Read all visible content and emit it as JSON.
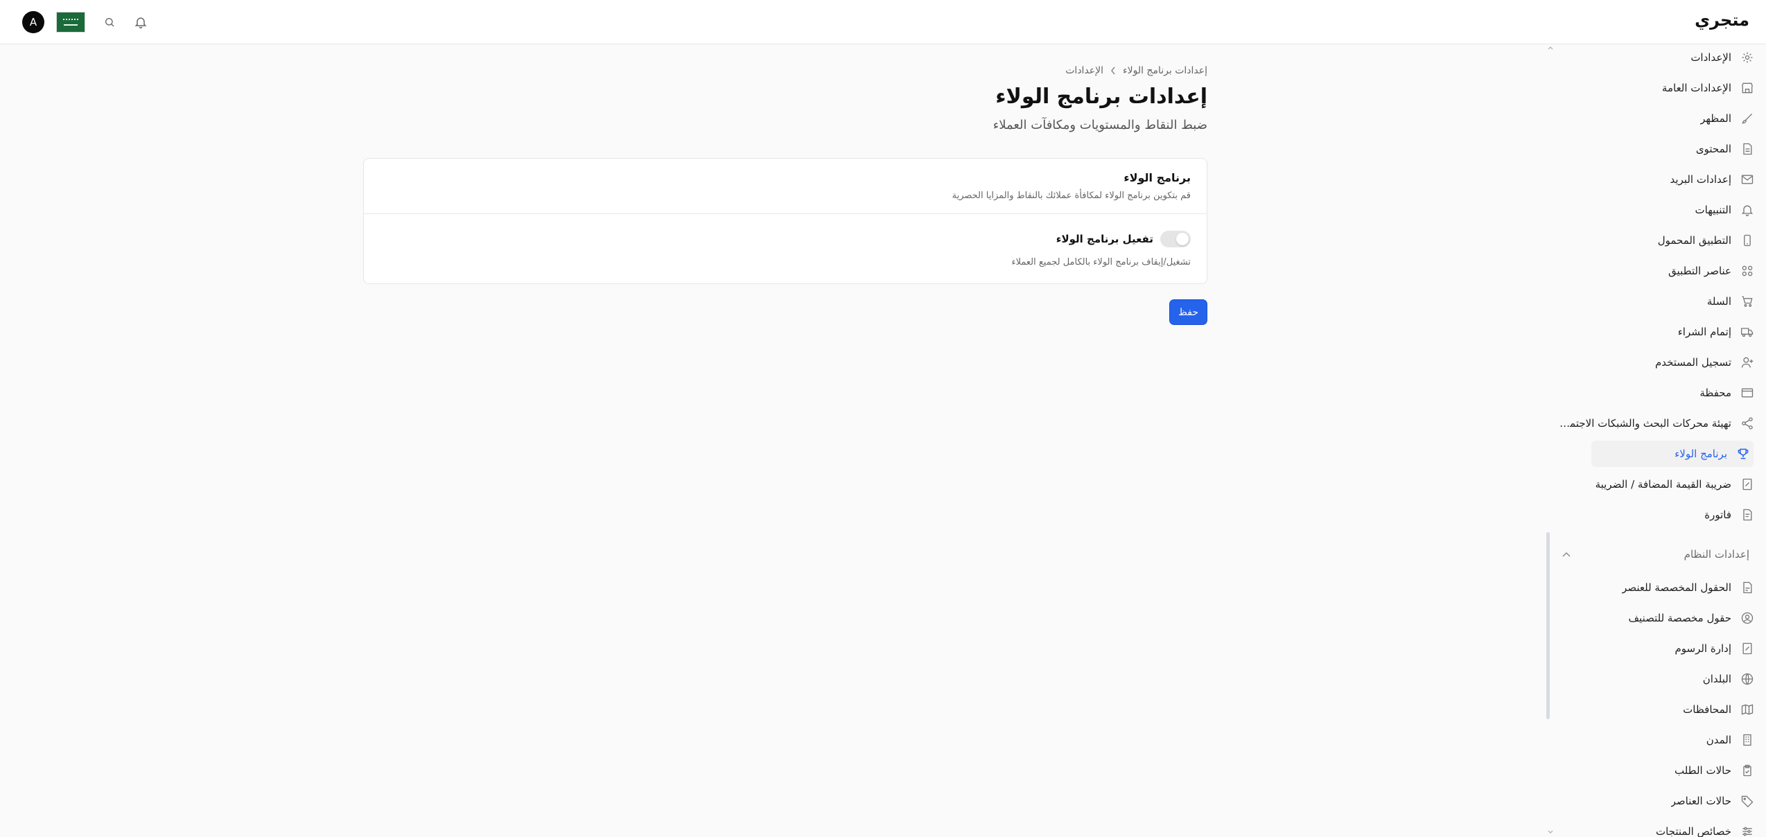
{
  "header": {
    "brand": "متجري",
    "avatar_initial": "A",
    "icons": [
      "bell-icon",
      "search-icon"
    ],
    "flag": "saudi-flag"
  },
  "sidebar": {
    "items": [
      {
        "label": "الإعدادات",
        "icon": "gear-icon"
      },
      {
        "label": "الإعدادات العامة",
        "icon": "store-icon"
      },
      {
        "label": "المظهر",
        "icon": "brush-icon"
      },
      {
        "label": "المحتوى",
        "icon": "document-icon"
      },
      {
        "label": "إعدادات البريد",
        "icon": "mail-icon"
      },
      {
        "label": "التنبيهات",
        "icon": "bell-icon"
      },
      {
        "label": "التطبيق المحمول",
        "icon": "phone-icon"
      },
      {
        "label": "عناصر التطبيق",
        "icon": "grid-icon"
      },
      {
        "label": "السلة",
        "icon": "cart-icon"
      },
      {
        "label": "إتمام الشراء",
        "icon": "truck-icon"
      },
      {
        "label": "تسجيل المستخدم",
        "icon": "user-plus-icon"
      },
      {
        "label": "محفظة",
        "icon": "wallet-icon"
      },
      {
        "label": "تهيئة محركات البحث والشبكات الاجتماعية",
        "icon": "share-icon"
      },
      {
        "label": "برنامج الولاء",
        "icon": "trophy-icon",
        "active": true
      },
      {
        "label": "ضريبة القيمة المضافة / الضريبة",
        "icon": "tax-icon"
      },
      {
        "label": "فاتورة",
        "icon": "invoice-icon"
      }
    ],
    "system_group": {
      "label": "إعدادات النظام",
      "items": [
        {
          "label": "الحقول المخصصة للعنصر",
          "icon": "file-fields-icon"
        },
        {
          "label": "حقول مخصصة للتصنيف",
          "icon": "user-circle-icon"
        },
        {
          "label": "إدارة الرسوم",
          "icon": "fees-icon"
        },
        {
          "label": "البلدان",
          "icon": "globe-icon"
        },
        {
          "label": "المحافظات",
          "icon": "map-icon"
        },
        {
          "label": "المدن",
          "icon": "building-icon"
        },
        {
          "label": "حالات الطلب",
          "icon": "clipboard-icon"
        },
        {
          "label": "حالات العناصر",
          "icon": "tag-icon"
        },
        {
          "label": "خصائص المنتجات",
          "icon": "sliders-icon"
        }
      ]
    }
  },
  "main": {
    "breadcrumb": {
      "parent": "الإعدادات",
      "current": "إعدادات برنامج الولاء"
    },
    "title": "إعدادات برنامج الولاء",
    "subtitle": "ضبط النقاط والمستويات ومكافآت العملاء",
    "card": {
      "title": "برنامج الولاء",
      "description": "قم بتكوين برنامج الولاء لمكافأة عملائك بالنقاط والمزايا الحصرية",
      "toggle_label": "تفعيل برنامج الولاء",
      "toggle_description": "تشغيل/إيقاف برنامج الولاء بالكامل لجميع العملاء",
      "toggle_on": false
    },
    "save_label": "حفظ"
  }
}
